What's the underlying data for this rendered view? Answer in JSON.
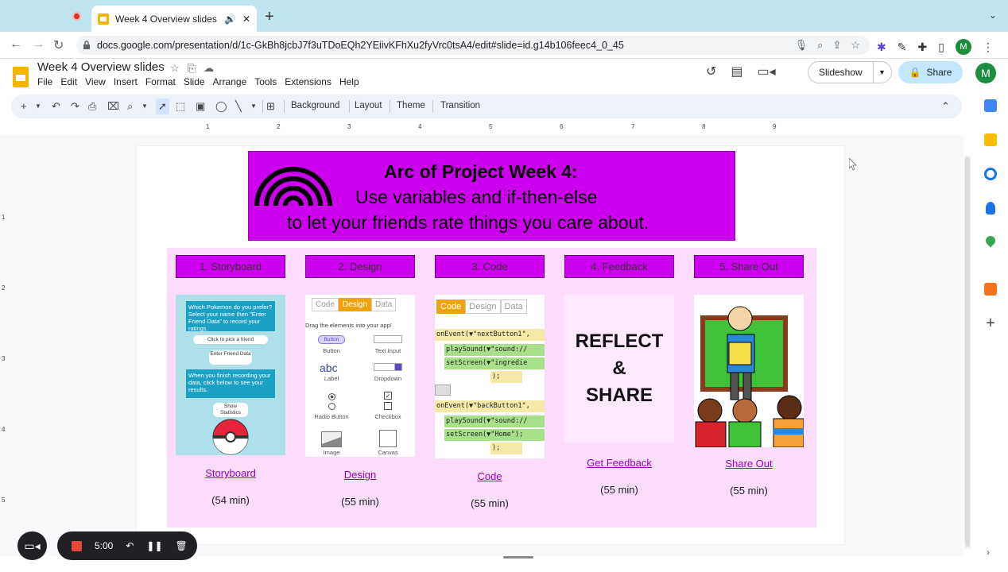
{
  "browser": {
    "tab_title": "Week 4 Overview slides - G",
    "url": "docs.google.com/presentation/d/1c-GkBh8jcbJ7f3uTDoEQh2YEiivKFhXu2fyVrc0tsA4/edit#slide=id.g14b106feec4_0_45",
    "profile_initial": "M"
  },
  "app": {
    "doc_title": "Week 4 Overview slides",
    "menus": [
      "File",
      "Edit",
      "View",
      "Insert",
      "Format",
      "Slide",
      "Arrange",
      "Tools",
      "Extensions",
      "Help"
    ],
    "slideshow_label": "Slideshow",
    "share_label": "Share",
    "account_initial": "M"
  },
  "toolbar": {
    "background": "Background",
    "layout": "Layout",
    "theme": "Theme",
    "transition": "Transition"
  },
  "ruler": [
    "1",
    "2",
    "3",
    "4",
    "5",
    "6",
    "7",
    "8",
    "9"
  ],
  "vruler": [
    "1",
    "2",
    "3",
    "4",
    "5"
  ],
  "slide": {
    "title": "Arc of Project Week 4:",
    "line2": "Use variables and if-then-else",
    "line3": "to let your friends rate things you care about.",
    "steps": [
      {
        "button": "1. Storyboard",
        "link": "Storyboard",
        "duration": "(54 min)"
      },
      {
        "button": "2. Design",
        "link": "Design",
        "duration": "(55 min)"
      },
      {
        "button": "3. Code",
        "link": "Code",
        "duration": "(55 min)"
      },
      {
        "button": "4. Feedback",
        "link": "Get Feedback",
        "duration": "(55 min)"
      },
      {
        "button": "5. Share Out",
        "link": "Share Out",
        "duration": "(55 min)"
      }
    ],
    "storyboard_img": {
      "q": "Which Pokemon do you prefer? Select your name then \"Enter Friend Data\" to record your ratings.",
      "pick": "Click to pick a friend",
      "enter": "Enter Friend Data",
      "done": "When you finish recording your data, click below to see your results.",
      "show": "Show Statistics"
    },
    "design_img": {
      "tabs": [
        "Code",
        "Design",
        "Data"
      ],
      "hint": "Drag the elements into your app!",
      "items": [
        "Button",
        "Text Input",
        "Label",
        "Dropdown",
        "Radio Button",
        "Checkbox",
        "Image",
        "Canvas"
      ],
      "sample_button": "Button",
      "sample_label": "abc"
    },
    "code_img": {
      "tabs": [
        "Code",
        "Design",
        "Data"
      ],
      "lines": [
        "onEvent(▼\"nextButton1\",",
        "playSound(▼\"sound://",
        "setScreen(▼\"ingredie",
        ");",
        "onEvent(▼\"backButton1\",",
        "playSound(▼\"sound://",
        "setScreen(▼\"Home\");",
        ");"
      ]
    },
    "reflect_text": [
      "REFLECT",
      "&",
      "SHARE"
    ]
  },
  "recorder": {
    "time": "5:00"
  },
  "colors": {
    "banner": "#cc00ee",
    "panel": "#fbdcfb",
    "link": "#9900cc",
    "tabbar": "#bfe6ef"
  }
}
